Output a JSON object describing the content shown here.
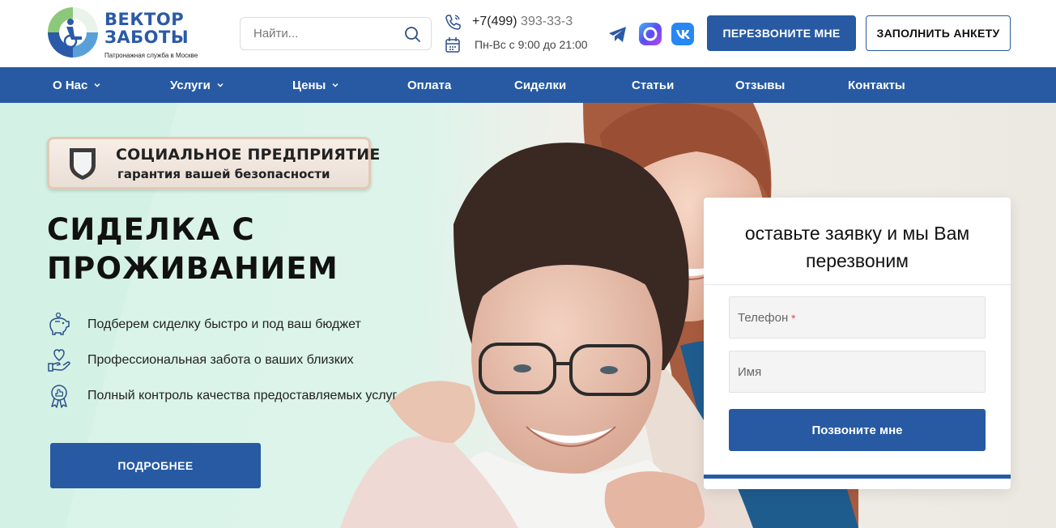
{
  "logo": {
    "line1": "ВЕКТОР",
    "line2": "ЗАБОТЫ",
    "tagline": "Патронажная служба в Москве"
  },
  "search": {
    "placeholder": "Найти..."
  },
  "contact": {
    "phone_visible": "+7(499)",
    "phone_faded": "393-33-3",
    "hours": "Пн-Вс с 9:00 до 21:00"
  },
  "social": [
    "telegram-icon",
    "max-messenger-icon",
    "vk-icon"
  ],
  "header_buttons": {
    "call": "ПЕРЕЗВОНИТЕ МНЕ",
    "form": "ЗАПОЛНИТЬ АНКЕТУ"
  },
  "nav": {
    "items": [
      {
        "label": "О Нас",
        "dropdown": true
      },
      {
        "label": "Услуги",
        "dropdown": true
      },
      {
        "label": "Цены",
        "dropdown": true
      },
      {
        "label": "Оплата",
        "dropdown": false
      },
      {
        "label": "Сиделки",
        "dropdown": false
      },
      {
        "label": "Статьи",
        "dropdown": false
      },
      {
        "label": "Отзывы",
        "dropdown": false
      },
      {
        "label": "Контакты",
        "dropdown": false
      }
    ]
  },
  "hero": {
    "badge_line1": "СОЦИАЛЬНОЕ ПРЕДПРИЯТИЕ",
    "badge_line2": "гарантия вашей безопасности",
    "title_line1": "СИДЕЛКА С",
    "title_line2": "ПРОЖИВАНИЕМ",
    "features": [
      {
        "icon": "piggy-bank-icon",
        "text": "Подберем сиделку быстро и под ваш бюджет"
      },
      {
        "icon": "heart-hand-icon",
        "text": "Профессиональная забота о ваших близких"
      },
      {
        "icon": "award-medal-icon",
        "text": "Полный контроль качества предоставляемых услуг"
      }
    ],
    "more_button": "ПОДРОБНЕЕ"
  },
  "callback_form": {
    "title_line1": "оставьте заявку и мы Вам",
    "title_line2": "перезвоним",
    "phone_placeholder": "Телефон",
    "required_mark": "*",
    "name_placeholder": "Имя",
    "submit": "Позвоните мне"
  },
  "colors": {
    "brand_blue": "#275aa3",
    "hero_mint": "#d8f3e9",
    "required_red": "#d9534f"
  }
}
